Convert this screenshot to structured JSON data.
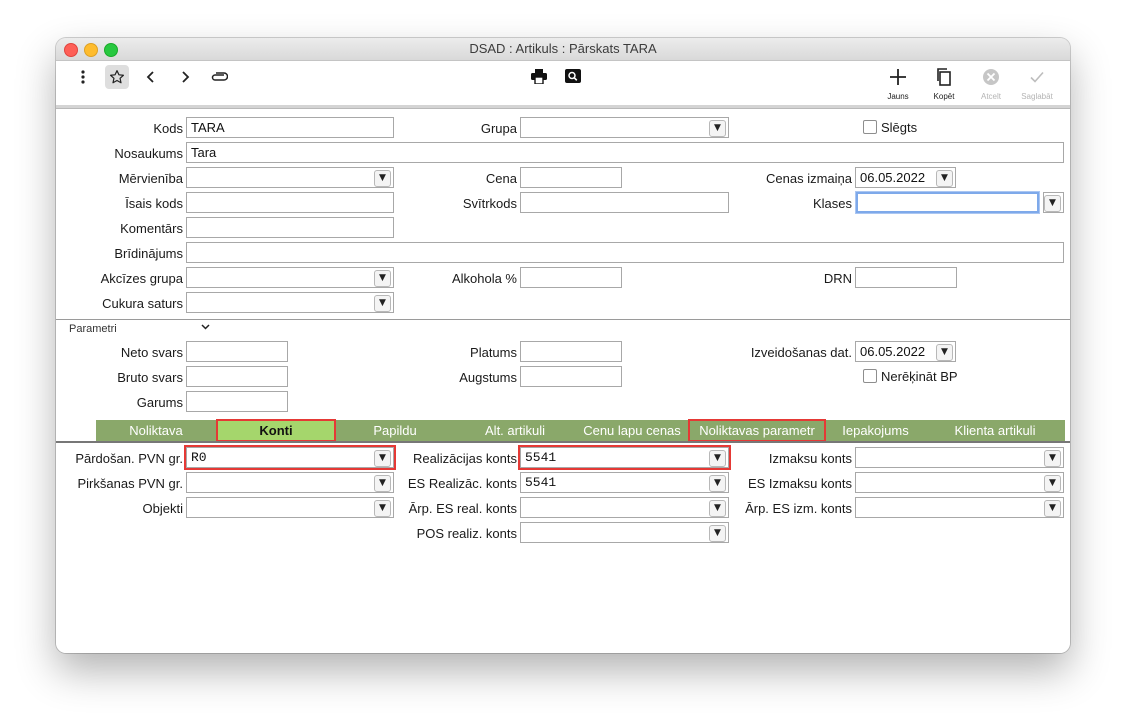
{
  "window": {
    "title": "DSAD : Artikuls : Pārskats TARA"
  },
  "toolbar": {
    "more_icon": "vertical-dots-icon",
    "star_icon": "star-icon",
    "back_icon": "chevron-left-icon",
    "forward_icon": "chevron-right-icon",
    "attach_icon": "paperclip-icon",
    "print_icon": "printer-icon",
    "search_icon": "magnifier-icon",
    "new_label": "Jauns",
    "copy_label": "Kopēt",
    "cancel_label": "Atcelt",
    "save_label": "Saglabāt"
  },
  "form": {
    "kods_label": "Kods",
    "kods_value": "TARA",
    "grupa_label": "Grupa",
    "grupa_value": "",
    "slegts_label": "Slēgts",
    "nosaukums_label": "Nosaukums",
    "nosaukums_value": "Tara",
    "mervieniba_label": "Mērvienība",
    "mervieniba_value": "",
    "cena_label": "Cena",
    "cena_value": "",
    "cenas_izmaina_label": "Cenas izmaiņa",
    "cenas_izmaina_value": "06.05.2022",
    "isais_kods_label": "Īsais kods",
    "isais_kods_value": "",
    "svitrkods_label": "Svītrkods",
    "svitrkods_value": "",
    "klases_label": "Klases",
    "klases_value": "",
    "komentars_label": "Komentārs",
    "komentars_value": "",
    "bridinajums_label": "Brīdinājums",
    "bridinajums_value": "",
    "akcizes_label": "Akcīzes grupa",
    "akcizes_value": "",
    "alkohola_label": "Alkohola %",
    "alkohola_value": "",
    "drn_label": "DRN",
    "drn_value": "",
    "cukura_label": "Cukura saturs",
    "cukura_value": ""
  },
  "params": {
    "title": "Parametri",
    "neto_label": "Neto svars",
    "neto_value": "",
    "platums_label": "Platums",
    "platums_value": "",
    "izveid_label": "Izveidošanas dat.",
    "izveid_value": "06.05.2022",
    "bruto_label": "Bruto svars",
    "bruto_value": "",
    "augstums_label": "Augstums",
    "augstums_value": "",
    "nerekinat_label": "Nerēķināt BP",
    "garums_label": "Garums",
    "garums_value": ""
  },
  "tabs": [
    "Noliktava",
    "Konti",
    "Papildu",
    "Alt. artikuli",
    "Cenu lapu cenas",
    "Noliktavas parametr",
    "Iepakojums",
    "Klienta artikuli"
  ],
  "konti": {
    "pardosan_label": "Pārdošan. PVN gr.",
    "pardosan_value": "R0",
    "realiz_label": "Realizācijas konts",
    "realiz_value": "5541",
    "izmaksu_label": "Izmaksu konts",
    "izmaksu_value": "",
    "pirksanas_label": "Pirkšanas PVN gr.",
    "pirksanas_value": "",
    "es_realiz_label": "ES Realizāc. konts",
    "es_realiz_value": "5541",
    "es_izmaksu_label": "ES Izmaksu konts",
    "es_izmaksu_value": "",
    "objekti_label": "Objekti",
    "objekti_value": "",
    "arp_es_real_label": "Ārp. ES real. konts",
    "arp_es_real_value": "",
    "arp_es_izm_label": "Ārp. ES izm. konts",
    "arp_es_izm_value": "",
    "pos_label": "POS realiz. konts",
    "pos_value": ""
  }
}
